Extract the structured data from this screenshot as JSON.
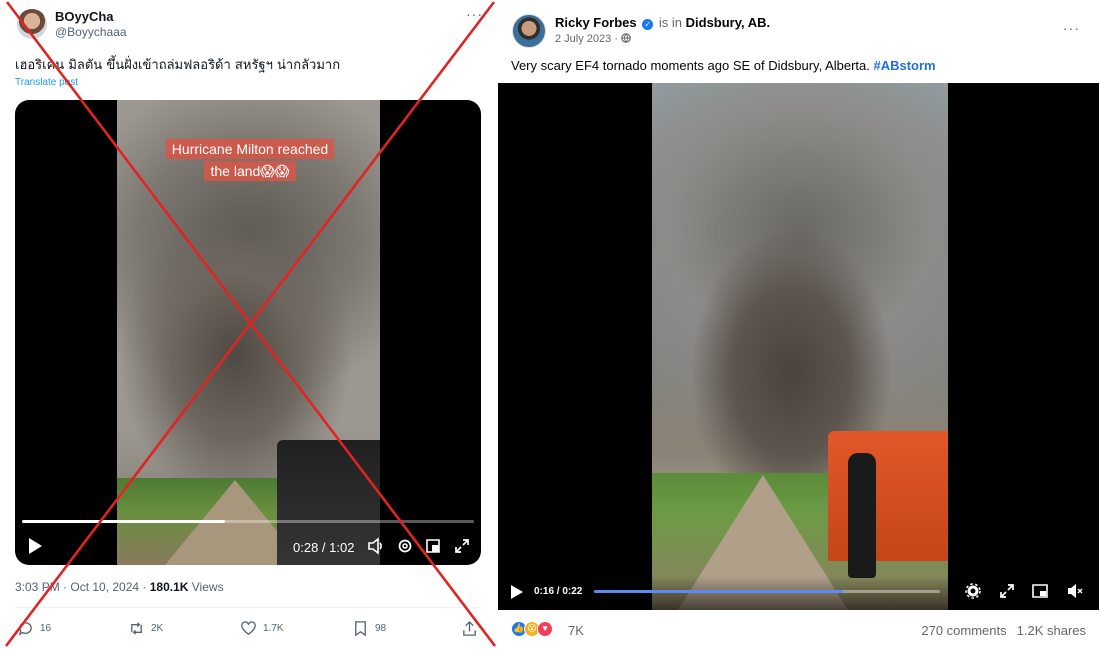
{
  "left_post": {
    "display_name": "BOyyCha",
    "handle": "@Boyychaaa",
    "more_label": "···",
    "text": "เฮอริเคน มิลตัน ขึ้นฝั่งเข้าถล่มฟลอริด้า สหรัฐฯ น่ากลัวมาก",
    "translate_label": "Translate post",
    "video": {
      "caption": "Hurricane Milton reached the land😱😱",
      "time": "0:28 / 1:02",
      "progress_fraction": 0.45
    },
    "timestamp": "3:03 PM · Oct 10, 2024 · ",
    "views_count": "180.1K",
    "views_label": " Views",
    "actions": {
      "replies": "16",
      "reposts": "2K",
      "likes": "1.7K",
      "bookmarks": "98"
    },
    "cross_color": "#e02424"
  },
  "right_post": {
    "author": "Ricky Forbes",
    "is_in_label": " is in ",
    "location": "Didsbury, AB.",
    "date": "2 July 2023 · ",
    "globe_icon": "globe-icon",
    "more_label": "···",
    "text": "Very scary EF4 tornado moments ago SE of Didsbury, Alberta. ",
    "hashtag": "#ABstorm",
    "video": {
      "time": "0:16 / 0:22",
      "progress_fraction": 0.72
    },
    "reaction_count": "7K",
    "comments": "270 comments",
    "shares": "1.2K shares",
    "brand_color": "#1877f2"
  }
}
